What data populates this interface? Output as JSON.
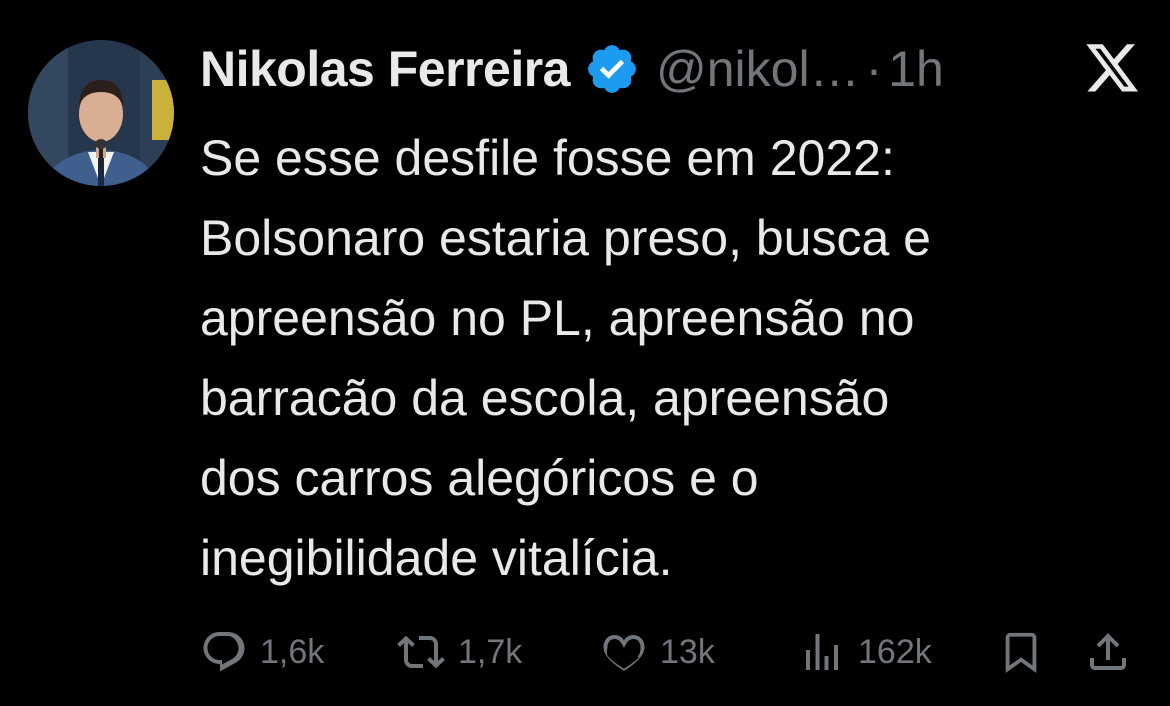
{
  "tweet": {
    "author_name": "Nikolas Ferreira",
    "handle": "@nikol…",
    "separator": "·",
    "time": "1h",
    "text": "Se esse desfile fosse em 2022:\nBolsonaro estaria preso, busca e\napreensão no PL, apreensão no\nbarracão da escola, apreensão\ndos carros alegóricos e o\ninegibilidade vitalícia."
  },
  "actions": {
    "replies": "1,6k",
    "reposts": "1,7k",
    "likes": "13k",
    "views": "162k"
  },
  "icons": {
    "verified": "verified-badge-icon",
    "x_logo": "x-logo-icon",
    "reply": "reply-icon",
    "repost": "repost-icon",
    "like": "heart-icon",
    "views": "views-icon",
    "bookmark": "bookmark-icon",
    "share": "share-icon"
  },
  "colors": {
    "background": "#000000",
    "text_primary": "#e7e9ea",
    "text_secondary": "#71767b",
    "verified": "#1d9bf0"
  }
}
